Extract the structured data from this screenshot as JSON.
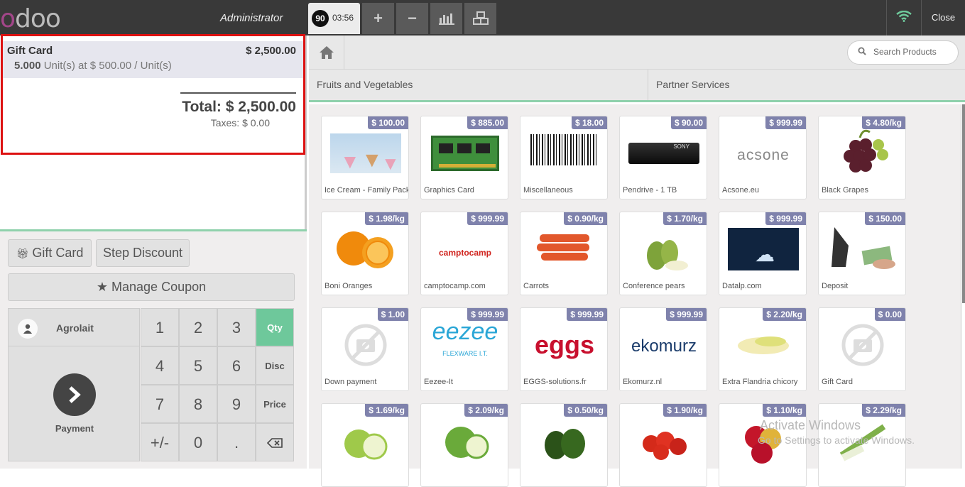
{
  "topbar": {
    "logo": "odoo",
    "user": "Administrator",
    "order_number": "90",
    "order_time": "03:56",
    "buttons": [
      "+",
      "−",
      "chart-icon",
      "boxes-icon"
    ],
    "close_label": "Close"
  },
  "order": {
    "line": {
      "product": "Gift Card",
      "price": "$ 2,500.00",
      "qty": "5.000",
      "unit_info": "Unit(s) at $ 500.00 / Unit(s)"
    },
    "total": "Total: $ 2,500.00",
    "taxes": "Taxes: $ 0.00"
  },
  "actions": {
    "gift_card": "Gift Card",
    "step_discount": "Step Discount",
    "manage_coupon": "Manage Coupon"
  },
  "numpad": {
    "customer": "Agrolait",
    "payment_label": "Payment",
    "keys": [
      "1",
      "2",
      "3",
      "Qty",
      "4",
      "5",
      "6",
      "Disc",
      "7",
      "8",
      "9",
      "Price",
      "+/-",
      "0",
      ".",
      "⌫"
    ]
  },
  "products_area": {
    "search_placeholder": "Search Products",
    "categories": [
      "Fruits and Vegetables",
      "Partner Services"
    ],
    "items": [
      {
        "name": "Ice Cream - Family Pack",
        "price": "$ 100.00"
      },
      {
        "name": "Graphics Card",
        "price": "$ 885.00"
      },
      {
        "name": "Miscellaneous",
        "price": "$ 18.00"
      },
      {
        "name": "Pendrive - 1 TB",
        "price": "$ 90.00"
      },
      {
        "name": "Acsone.eu",
        "price": "$ 999.99"
      },
      {
        "name": "Black Grapes",
        "price": "$ 4.80/kg"
      },
      {
        "name": "Boni Oranges",
        "price": "$ 1.98/kg"
      },
      {
        "name": "camptocamp.com",
        "price": "$ 999.99"
      },
      {
        "name": "Carrots",
        "price": "$ 0.90/kg"
      },
      {
        "name": "Conference pears",
        "price": "$ 1.70/kg"
      },
      {
        "name": "Datalp.com",
        "price": "$ 999.99"
      },
      {
        "name": "Deposit",
        "price": "$ 150.00"
      },
      {
        "name": "Down payment",
        "price": "$ 1.00"
      },
      {
        "name": "Eezee-It",
        "price": "$ 999.99"
      },
      {
        "name": "EGGS-solutions.fr",
        "price": "$ 999.99"
      },
      {
        "name": "Ekomurz.nl",
        "price": "$ 999.99"
      },
      {
        "name": "Extra Flandria chicory",
        "price": "$ 2.20/kg"
      },
      {
        "name": "Gift Card",
        "price": "$ 0.00"
      },
      {
        "name": "",
        "price": "$ 1.69/kg"
      },
      {
        "name": "",
        "price": "$ 2.09/kg"
      },
      {
        "name": "",
        "price": "$ 0.50/kg"
      },
      {
        "name": "",
        "price": "$ 1.90/kg"
      },
      {
        "name": "",
        "price": "$ 1.10/kg"
      },
      {
        "name": "",
        "price": "$ 2.29/kg"
      }
    ],
    "image_labels": {
      "acsone": "acsone",
      "camptocamp": "camptocamp",
      "eezee": "eezee",
      "eezee_sub": "FLEXWARE I.T.",
      "eggs": "eggs",
      "ekomurz": "ekomurz"
    }
  },
  "watermark": {
    "title": "Activate Windows",
    "subtitle": "Go to Settings to activate Windows."
  },
  "colors": {
    "accent": "#6ec89b",
    "price_badge": "#7f82ac",
    "selection_border": "#dd1111",
    "topbar": "#393939"
  }
}
